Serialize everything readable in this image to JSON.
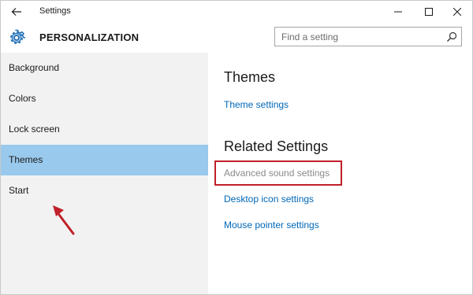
{
  "titlebar": {
    "title": "Settings",
    "back_icon": "back-arrow-icon",
    "controls": [
      "minimize-icon",
      "maximize-icon",
      "close-icon"
    ]
  },
  "header": {
    "icon": "gear-icon",
    "title": "PERSONALIZATION",
    "search": {
      "placeholder": "Find a setting",
      "value": ""
    }
  },
  "sidebar": {
    "items": [
      {
        "label": "Background",
        "selected": false
      },
      {
        "label": "Colors",
        "selected": false
      },
      {
        "label": "Lock screen",
        "selected": false
      },
      {
        "label": "Themes",
        "selected": true
      },
      {
        "label": "Start",
        "selected": false
      }
    ],
    "selected_color": "#99c9ec"
  },
  "content": {
    "themes_heading": "Themes",
    "theme_settings_link": "Theme settings",
    "related_heading": "Related Settings",
    "related_links": [
      {
        "label": "Advanced sound settings",
        "enabled": false
      },
      {
        "label": "Desktop icon settings",
        "enabled": true
      },
      {
        "label": "Mouse pointer settings",
        "enabled": true
      }
    ]
  },
  "colors": {
    "link": "#0067b8",
    "disabled_link": "#8a8a8a",
    "annotation": "#c0202a",
    "sidebar_bg": "#f2f2f2"
  }
}
